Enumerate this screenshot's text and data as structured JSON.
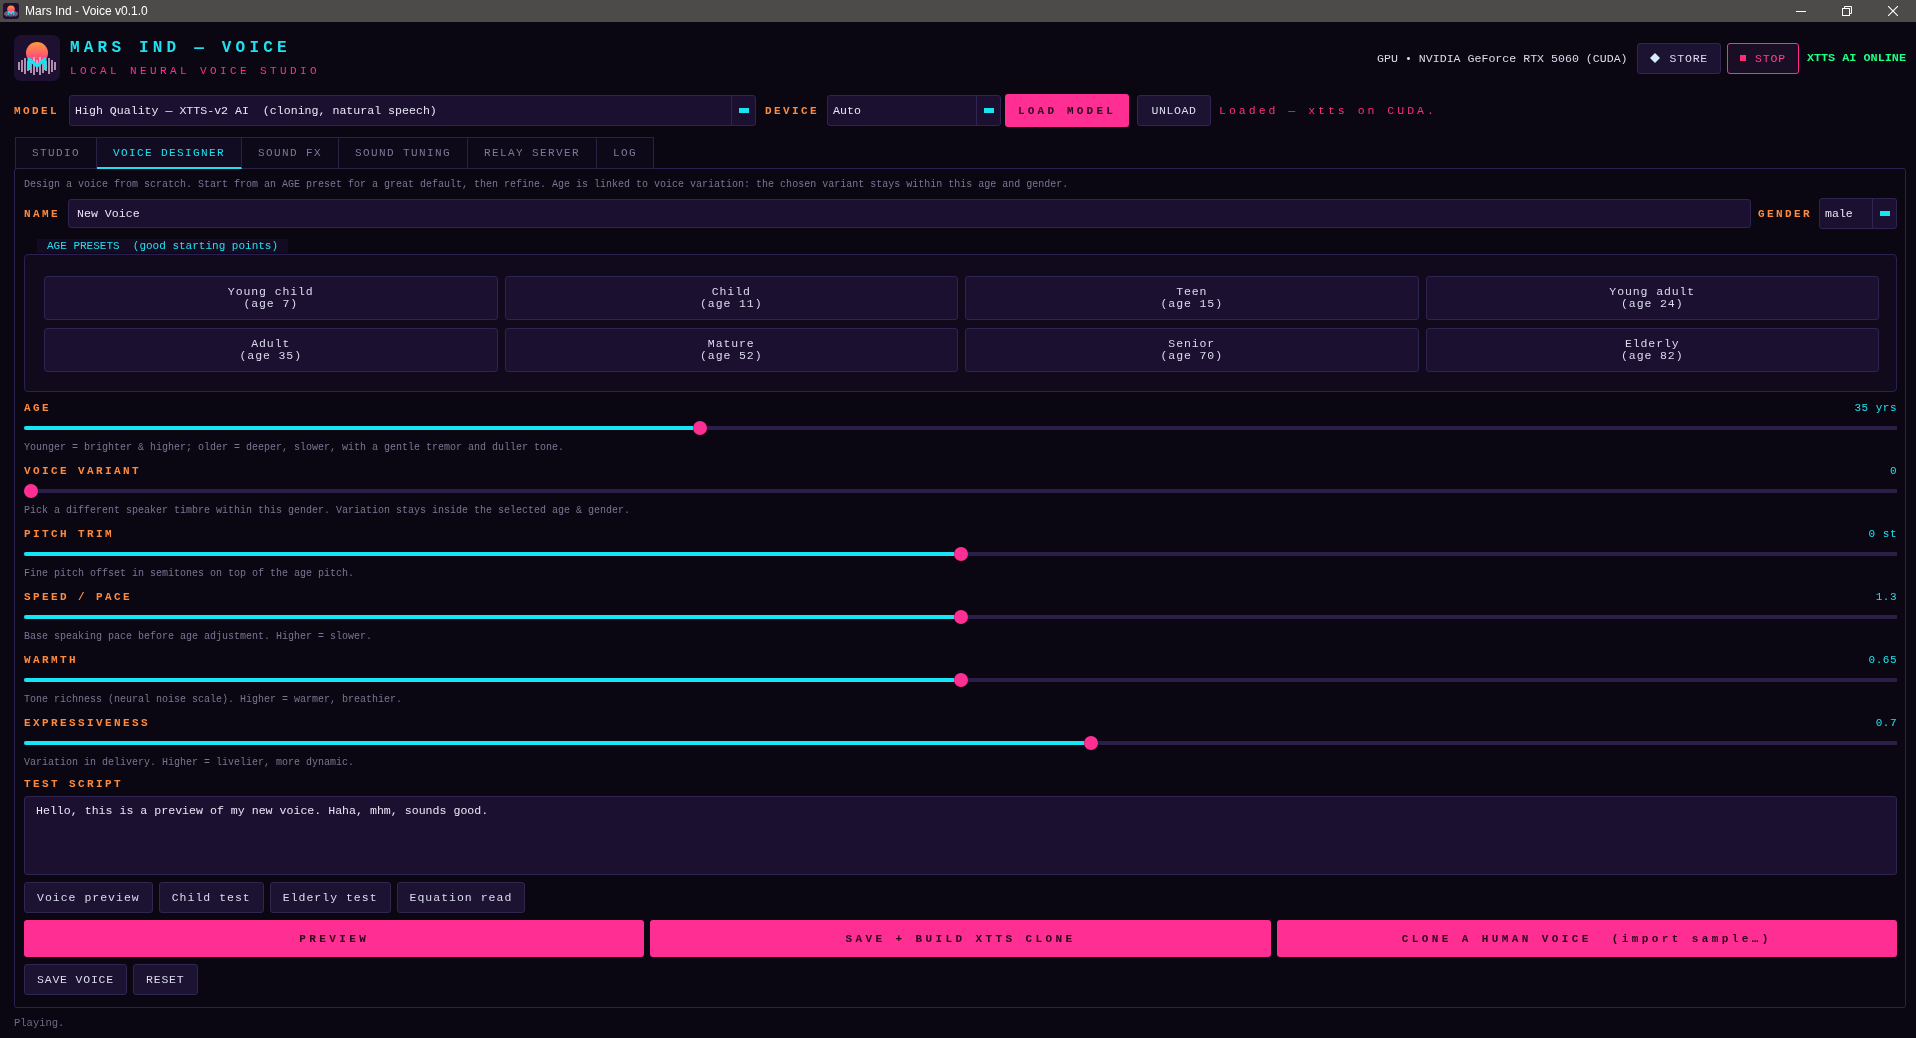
{
  "window": {
    "title": "Mars Ind - Voice v0.1.0"
  },
  "header": {
    "title": "MARS IND — VOICE",
    "subtitle": "LOCAL NEURAL VOICE STUDIO",
    "gpu": "GPU • NVIDIA GeForce RTX 5060 (CUDA)",
    "buttons": [
      {
        "label": "STORE",
        "kind": "store"
      },
      {
        "label": "STOP",
        "kind": "stop"
      }
    ],
    "engine_status": "XTTS AI ONLINE"
  },
  "model_bar": {
    "model_label": "MODEL",
    "model": "High Quality — XTTS-v2 AI  (cloning, natural speech)",
    "device_label": "DEVICE",
    "device": "Auto",
    "buttons": [
      {
        "label": "LOAD MODEL",
        "kind": "primary"
      },
      {
        "label": "UNLOAD",
        "kind": "secondary"
      }
    ],
    "status": "Loaded — xtts on CUDA."
  },
  "tabs": [
    {
      "label": "STUDIO",
      "selected": false
    },
    {
      "label": "VOICE DESIGNER",
      "selected": true
    },
    {
      "label": "SOUND FX",
      "selected": false
    },
    {
      "label": "SOUND TUNING",
      "selected": false
    },
    {
      "label": "RELAY SERVER",
      "selected": false
    },
    {
      "label": "LOG",
      "selected": false
    }
  ],
  "designer": {
    "description": "Design a voice from scratch. Start from an AGE preset for a great default, then refine. Age is linked to voice variation: the chosen variant stays within this age and gender.",
    "name_label": "NAME",
    "name": "New Voice",
    "gender_label": "GENDER",
    "gender": "male",
    "presets": {
      "legend": "AGE PRESETS  (good starting points)",
      "items": [
        {
          "name": "Young child",
          "age": "(age 7)"
        },
        {
          "name": "Child",
          "age": "(age 11)"
        },
        {
          "name": "Teen",
          "age": "(age 15)"
        },
        {
          "name": "Young adult",
          "age": "(age 24)"
        },
        {
          "name": "Adult",
          "age": "(age 35)"
        },
        {
          "name": "Mature",
          "age": "(age 52)"
        },
        {
          "name": "Senior",
          "age": "(age 70)"
        },
        {
          "name": "Elderly",
          "age": "(age 82)"
        }
      ]
    },
    "sliders": [
      {
        "label": "AGE",
        "reading": "35 yrs",
        "level": 0.36,
        "hint": "Younger = brighter & higher; older = deeper, slower, with a gentle tremor and duller tone."
      },
      {
        "label": "VOICE VARIANT",
        "reading": "0",
        "level": 0,
        "hint": "Pick a different speaker timbre within this gender. Variation stays inside the selected age & gender."
      },
      {
        "label": "PITCH TRIM",
        "reading": "0 st",
        "level": 0.5,
        "hint": "Fine pitch offset in semitones on top of the age pitch."
      },
      {
        "label": "SPEED / PACE",
        "reading": "1.3",
        "level": 0.5,
        "hint": "Base speaking pace before age adjustment. Higher = slower."
      },
      {
        "label": "WARMTH",
        "reading": "0.65",
        "level": 0.5,
        "hint": "Tone richness (neural noise scale). Higher = warmer, breathier."
      },
      {
        "label": "EXPRESSIVENESS",
        "reading": "0.7",
        "level": 0.57,
        "hint": "Variation in delivery. Higher = livelier, more dynamic."
      }
    ],
    "script_label": "TEST SCRIPT",
    "script": "Hello, this is a preview of my new voice. Haha, mhm, sounds good.",
    "samples": [
      "Voice preview",
      "Child test",
      "Elderly test",
      "Equation read"
    ],
    "actions": [
      "PREVIEW",
      "SAVE + BUILD XTTS CLONE",
      "CLONE A HUMAN VOICE  (import sample…)"
    ],
    "file_buttons": [
      "SAVE VOICE",
      "RESET"
    ]
  },
  "status_bar": "Playing."
}
